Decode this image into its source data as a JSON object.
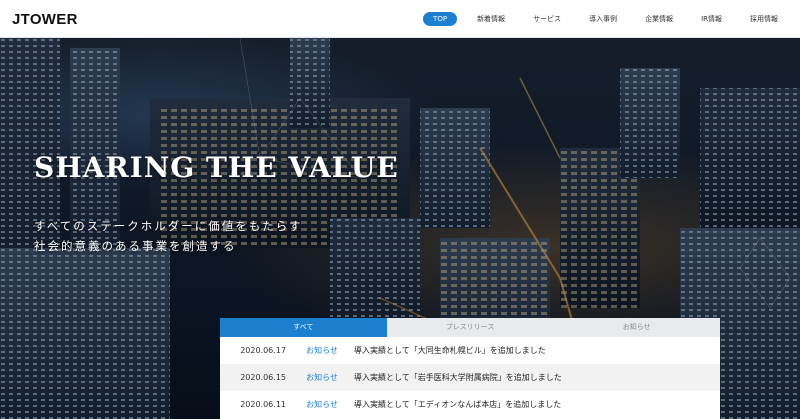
{
  "header": {
    "logo": "JTOWER",
    "nav": [
      {
        "label": "TOP",
        "active": true
      },
      {
        "label": "新着情報",
        "active": false
      },
      {
        "label": "サービス",
        "active": false
      },
      {
        "label": "導入事例",
        "active": false
      },
      {
        "label": "企業情報",
        "active": false
      },
      {
        "label": "IR情報",
        "active": false
      },
      {
        "label": "採用情報",
        "active": false
      }
    ]
  },
  "hero": {
    "title": "SHARING THE VALUE",
    "subtitle_line1": "すべてのステークホルダーに価値をもたらす",
    "subtitle_line2": "社会的意義のある事業を創造する"
  },
  "news": {
    "tabs": [
      "すべて",
      "プレスリリース",
      "お知らせ"
    ],
    "items": [
      {
        "date": "2020.06.17",
        "category": "お知らせ",
        "title": "導入実績として「大同生命札幌ビル」を追加しました"
      },
      {
        "date": "2020.06.15",
        "category": "お知らせ",
        "title": "導入実績として「岩手医科大学附属病院」を追加しました"
      },
      {
        "date": "2020.06.11",
        "category": "お知らせ",
        "title": "導入実績として「エディオンなんば本店」を追加しました"
      }
    ]
  },
  "colors": {
    "accent": "#1d7fd0"
  }
}
